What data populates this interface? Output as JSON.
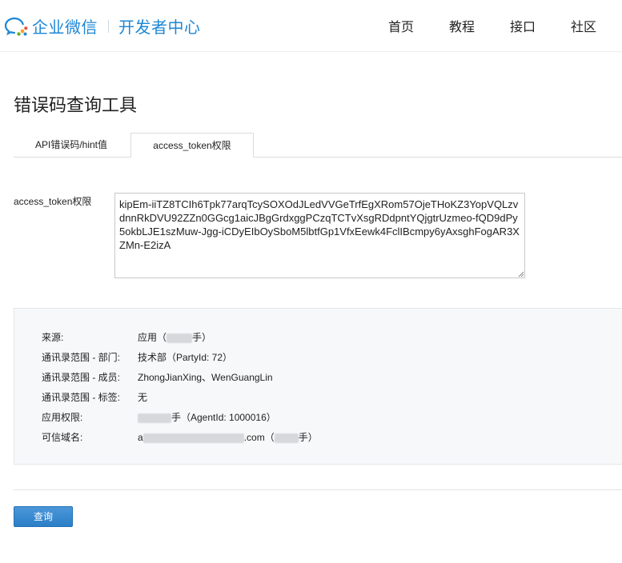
{
  "header": {
    "brand": "企业微信",
    "subbrand": "开发者中心",
    "nav": [
      "首页",
      "教程",
      "接口",
      "社区"
    ]
  },
  "page": {
    "title": "错误码查询工具"
  },
  "tabs": [
    {
      "label": "API错误码/hint值",
      "active": false
    },
    {
      "label": "access_token权限",
      "active": true
    }
  ],
  "form": {
    "label": "access_token权限",
    "token_value": "kipEm-iiTZ8TCIh6Tpk77arqTcySOXOdJLedVVGeTrfEgXRom57OjeTHoKZ3YopVQLzvdnnRkDVU92ZZn0GGcg1aicJBgGrdxggPCzqTCTvXsgRDdpntYQjgtrUzmeo-fQD9dPy5okbLJE1szMuw-Jgg-iCDyEIbOySboM5lbtfGp1VfxEewk4FclIBcmpy6yAxsghFogAR3XZMn-E2izA"
  },
  "result": {
    "source": {
      "key": "来源:",
      "prefix": "应用（",
      "suffix": "手）"
    },
    "dept": {
      "key": "通讯录范围 - 部门:",
      "value": "技术部（PartyId: 72）"
    },
    "members": {
      "key": "通讯录范围 - 成员:",
      "value": "ZhongJianXing、WenGuangLin"
    },
    "tags": {
      "key": "通讯录范围 - 标签:",
      "value": "无"
    },
    "perm": {
      "key": "应用权限:",
      "suffix": "手（AgentId: 1000016）"
    },
    "domain": {
      "key": "可信域名:",
      "prefix": "a",
      "mid": ".com（",
      "suffix": "手）"
    }
  },
  "actions": {
    "query_label": "查询"
  },
  "colors": {
    "brand": "#1e87d6",
    "button": "#2b7fc7",
    "panel": "#f7f8fa"
  }
}
